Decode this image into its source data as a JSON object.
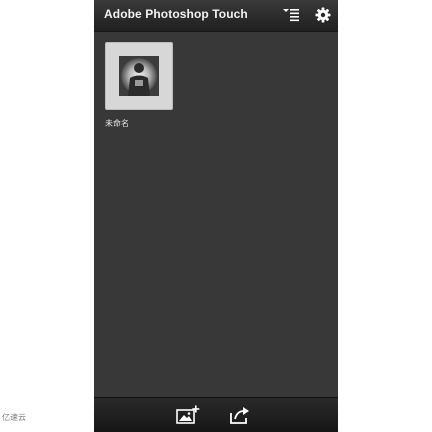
{
  "header": {
    "title": "Adobe Photoshop Touch",
    "sort_icon": "sort-list-icon",
    "settings_icon": "gear-icon"
  },
  "projects": [
    {
      "name": "未命名",
      "thumbnail_icon": "photo-thumbnail"
    }
  ],
  "toolbar": {
    "add_icon": "add-image-icon",
    "share_icon": "share-icon"
  },
  "watermark": {
    "text": "亿速云"
  },
  "colors": {
    "background": "#383838",
    "bar": "#1f1f1f",
    "text": "#f2f2f2"
  }
}
